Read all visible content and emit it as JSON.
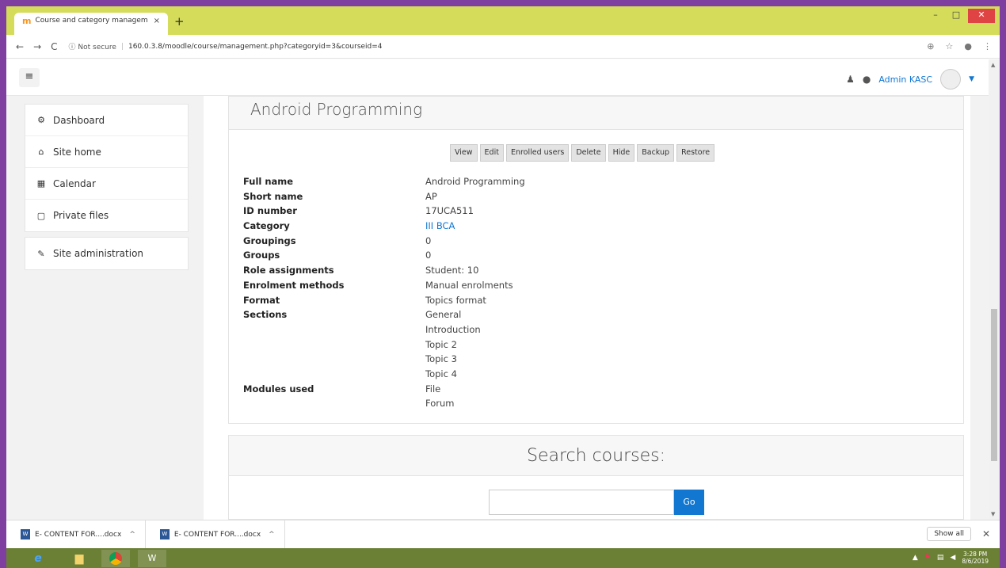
{
  "browser": {
    "tab_title": "Course and category managem",
    "tab_close": "×",
    "new_tab": "+",
    "back": "←",
    "forward": "→",
    "reload": "C",
    "security": "ⓘ Not secure",
    "separator": "|",
    "url": "160.0.3.8/moodle/course/management.php?categoryid=3&courseid=4",
    "zoom_icon": "⊕",
    "star_icon": "☆",
    "profile_icon": "●",
    "menu_icon": "⋮",
    "win_min": "–",
    "win_max": "□",
    "win_close": "✕"
  },
  "navbar": {
    "menu_icon": "≡",
    "bell_icon": "♟",
    "chat_icon": "●",
    "user_name": "Admin KASC",
    "caret": "▼"
  },
  "sidebar": {
    "group1": [
      {
        "label": "Dashboard",
        "icon": "⚙"
      },
      {
        "label": "Site home",
        "icon": "⌂"
      },
      {
        "label": "Calendar",
        "icon": "▦"
      },
      {
        "label": "Private files",
        "icon": "▢"
      }
    ],
    "group2": [
      {
        "label": "Site administration",
        "icon": "✎"
      }
    ]
  },
  "course": {
    "title": "Android Programming",
    "buttons": [
      "View",
      "Edit",
      "Enrolled users",
      "Delete",
      "Hide",
      "Backup",
      "Restore"
    ],
    "details": {
      "full_name": {
        "label": "Full name",
        "value": "Android Programming"
      },
      "short_name": {
        "label": "Short name",
        "value": "AP"
      },
      "id_number": {
        "label": "ID number",
        "value": "17UCA511"
      },
      "category": {
        "label": "Category",
        "value": "III BCA"
      },
      "groupings": {
        "label": "Groupings",
        "value": "0"
      },
      "groups": {
        "label": "Groups",
        "value": "0"
      },
      "role_assignments": {
        "label": "Role assignments",
        "value": "Student: 10"
      },
      "enrolment_methods": {
        "label": "Enrolment methods",
        "value": "Manual enrolments"
      },
      "format": {
        "label": "Format",
        "value": "Topics format"
      },
      "sections": {
        "label": "Sections",
        "values": [
          "General",
          "Introduction",
          "Topic 2",
          "Topic 3",
          "Topic 4"
        ]
      },
      "modules_used": {
        "label": "Modules used",
        "values": [
          "File",
          "Forum"
        ]
      }
    }
  },
  "search": {
    "heading": "Search courses:",
    "go_label": "Go",
    "input_value": ""
  },
  "downloads": {
    "items": [
      {
        "name": "E- CONTENT FOR....docx",
        "caret": "^"
      },
      {
        "name": "E- CONTENT FOR....docx",
        "caret": "^"
      }
    ],
    "show_all": "Show all",
    "close": "✕"
  },
  "taskbar": {
    "ie": "e",
    "folder": "▆",
    "word": "W",
    "tray_arrow": "▲",
    "time": "3:28 PM",
    "date": "8/6/2019"
  }
}
